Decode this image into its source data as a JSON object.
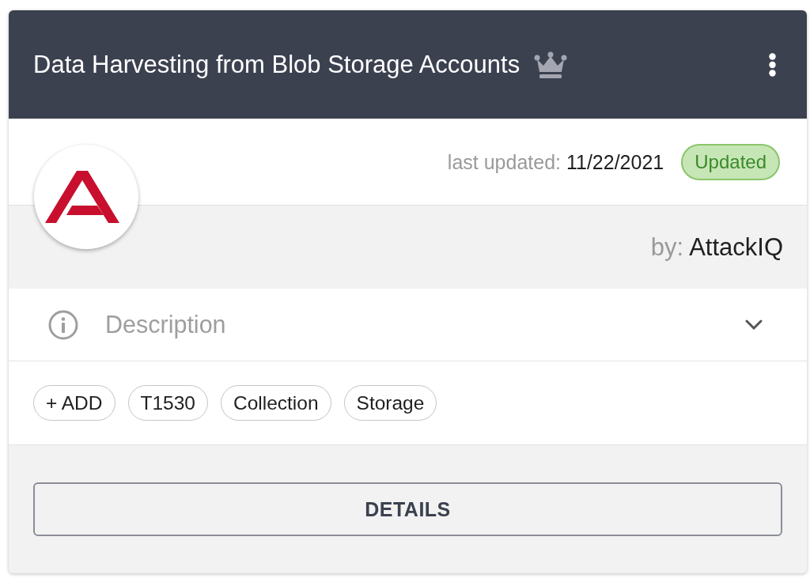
{
  "card": {
    "title": "Data Harvesting from Blob Storage Accounts",
    "meta": {
      "last_updated_label": "last updated:",
      "last_updated": "11/22/2021",
      "badge": "Updated",
      "author_label": "by:",
      "author": "AttackIQ"
    },
    "description": {
      "label": "Description",
      "expanded": false
    },
    "add_tag_button": "+ ADD",
    "tags": [
      "T1530",
      "Collection",
      "Storage"
    ],
    "button": "DETAILS"
  }
}
